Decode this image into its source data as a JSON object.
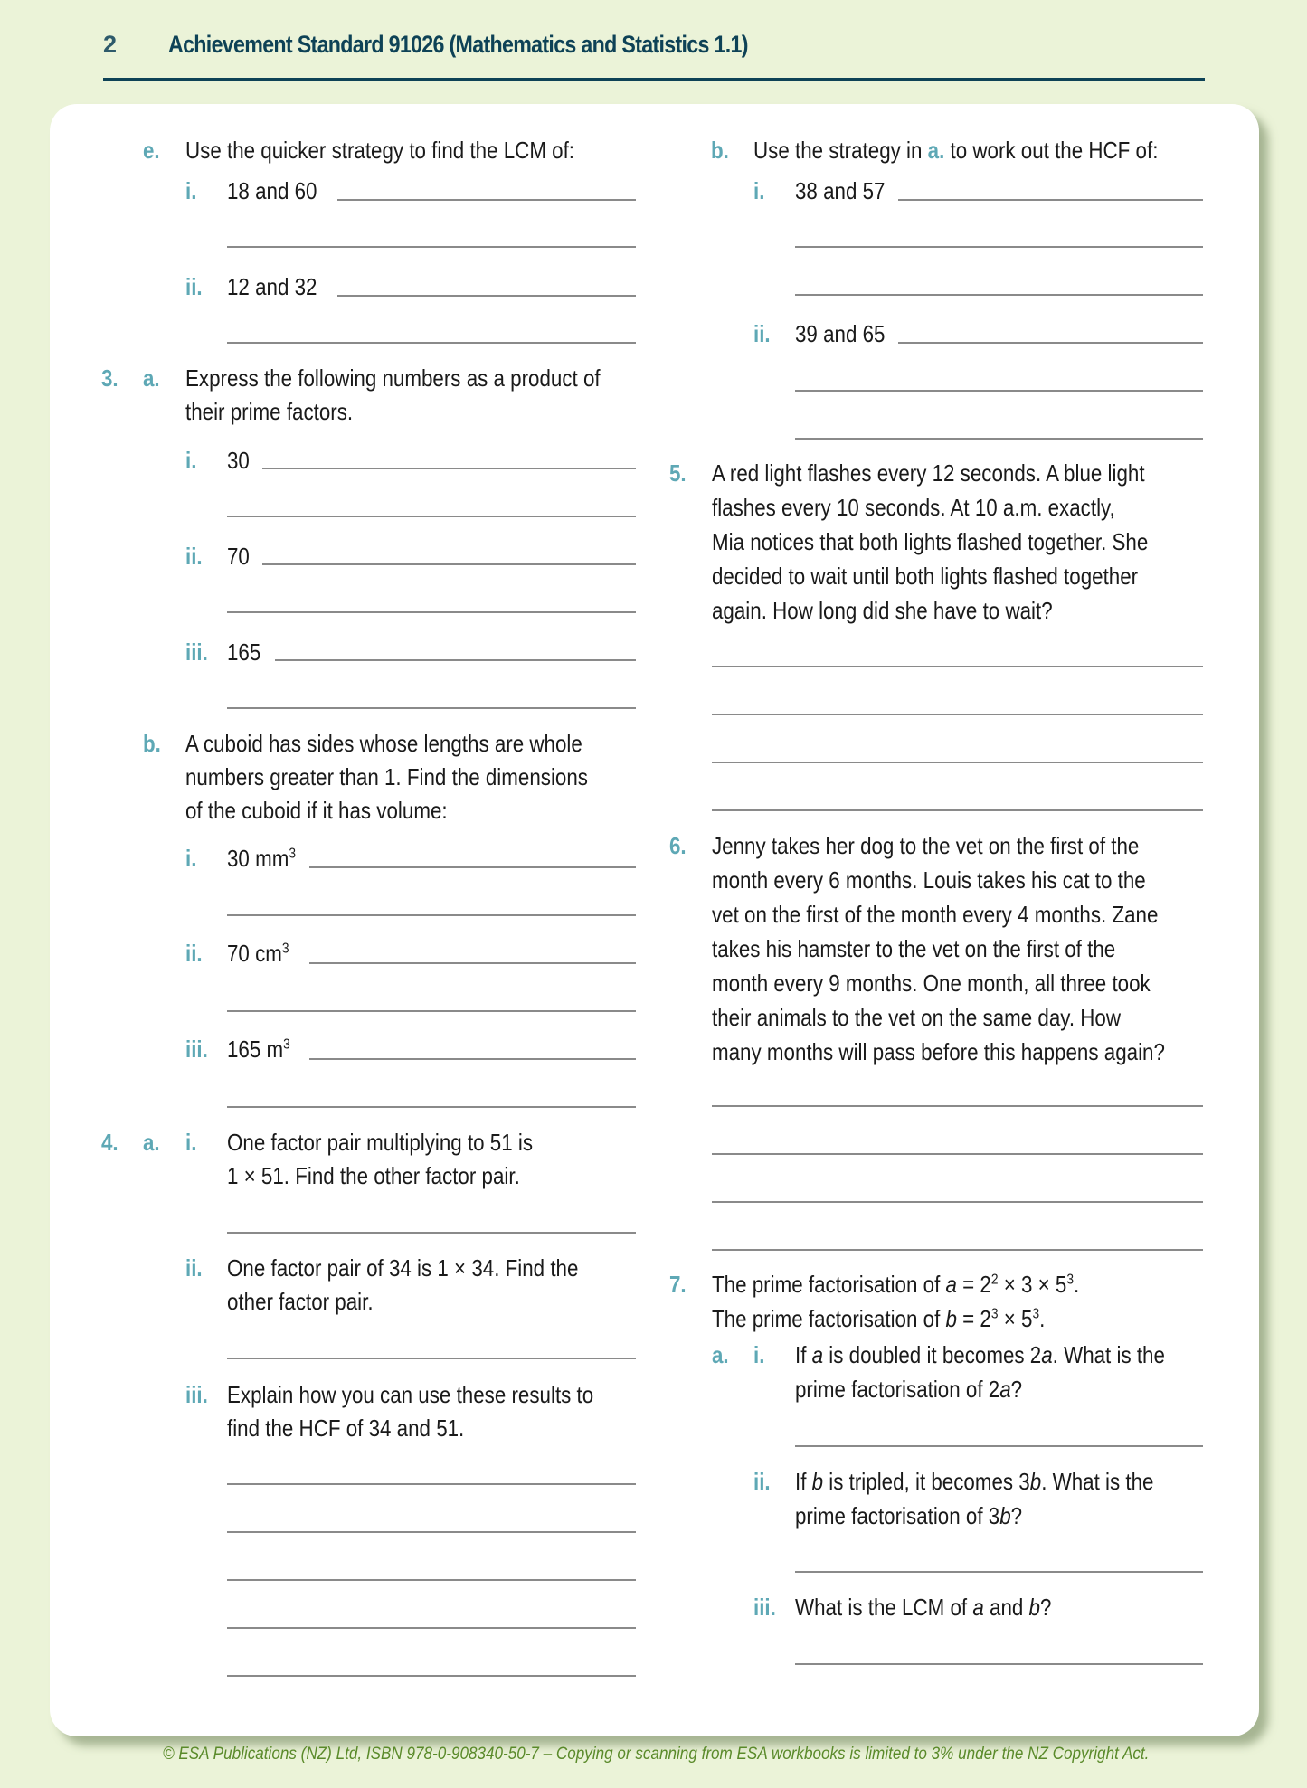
{
  "header": {
    "page_number": "2",
    "title": "Achievement Standard 91026 (Mathematics and Statistics 1.1)"
  },
  "left": {
    "q2e": {
      "label": "e.",
      "text": "Use the quicker strategy to find the LCM of:",
      "items": [
        {
          "label": "i.",
          "text": "18 and 60"
        },
        {
          "label": "ii.",
          "text": "12 and 32"
        }
      ]
    },
    "q3": {
      "number": "3.",
      "a": {
        "label": "a.",
        "lines": [
          "Express the following numbers as a product of",
          "their prime factors."
        ],
        "items": [
          {
            "label": "i.",
            "text": "30"
          },
          {
            "label": "ii.",
            "text": "70"
          },
          {
            "label": "iii.",
            "text": "165"
          }
        ]
      },
      "b": {
        "label": "b.",
        "lines": [
          "A cuboid has sides whose lengths are whole",
          "numbers greater than 1. Find the dimensions",
          "of the cuboid if it has volume:"
        ],
        "items": [
          {
            "label": "i.",
            "text": "30 mm",
            "sup": "3"
          },
          {
            "label": "ii.",
            "text": "70 cm",
            "sup": "3"
          },
          {
            "label": "iii.",
            "text": "165 m",
            "sup": "3"
          }
        ]
      }
    },
    "q4": {
      "number": "4.",
      "part": "a.",
      "items": [
        {
          "label": "i.",
          "lines": [
            "One factor pair multiplying to 51 is",
            "1 × 51. Find the other factor pair."
          ]
        },
        {
          "label": "ii.",
          "lines": [
            "One factor pair of 34 is 1 × 34. Find the",
            "other factor pair."
          ]
        },
        {
          "label": "iii.",
          "lines": [
            "Explain how you can use these results to",
            "find the HCF of 34 and 51."
          ]
        }
      ]
    }
  },
  "right": {
    "q4b": {
      "label": "b.",
      "text_before": "Use the strategy in ",
      "ref": "a.",
      "text_after": " to work out the HCF of:",
      "items": [
        {
          "label": "i.",
          "text": "38 and 57"
        },
        {
          "label": "ii.",
          "text": "39 and 65"
        }
      ]
    },
    "q5": {
      "number": "5.",
      "lines": [
        "A red light flashes every 12 seconds. A blue light",
        "flashes every 10 seconds. At 10 a.m. exactly,",
        "Mia notices that both lights flashed together. She",
        "decided to wait until both lights flashed together",
        "again. How long did she have to wait?"
      ]
    },
    "q6": {
      "number": "6.",
      "lines": [
        "Jenny takes her dog to the vet on the first of the",
        "month every 6 months. Louis takes his cat to the",
        "vet on the first of the month every 4 months. Zane",
        "takes his hamster to the vet on the first of the",
        "month every 9 months. One month, all three took",
        "their animals to the vet on the same day. How",
        "many months will pass before this happens again?"
      ]
    },
    "q7": {
      "number": "7.",
      "line1": {
        "pre": "The prime factorisation of ",
        "var": "a",
        "eq": " = 2",
        "e1": "2",
        "mid": " × 3 × 5",
        "e2": "3",
        "end": "."
      },
      "line2": {
        "pre": "The prime factorisation of ",
        "var": "b",
        "eq": " = 2",
        "e1": "3",
        "mid": " × 5",
        "e2": "3",
        "end": "."
      },
      "part": "a.",
      "items": [
        {
          "label": "i.",
          "l1a": "If ",
          "l1v": "a",
          "l1b": " is doubled it becomes 2",
          "l1v2": "a",
          "l1c": ". What is the",
          "l2a": "prime factorisation of 2",
          "l2v": "a",
          "l2b": "?"
        },
        {
          "label": "ii.",
          "l1a": "If ",
          "l1v": "b",
          "l1b": " is tripled, it becomes 3",
          "l1v2": "b",
          "l1c": ". What is the",
          "l2a": "prime factorisation of 3",
          "l2v": "b",
          "l2b": "?"
        },
        {
          "label": "iii.",
          "l1a": "What is the LCM of ",
          "l1v": "a",
          "l1b": " and ",
          "l1v2": "b",
          "l1c": "?"
        }
      ]
    }
  },
  "footer": {
    "text": "© ESA Publications (NZ) Ltd, ISBN 978-0-908340-50-7 –  Copying or scanning from ESA workbooks is limited to 3% under the NZ Copyright Act."
  }
}
